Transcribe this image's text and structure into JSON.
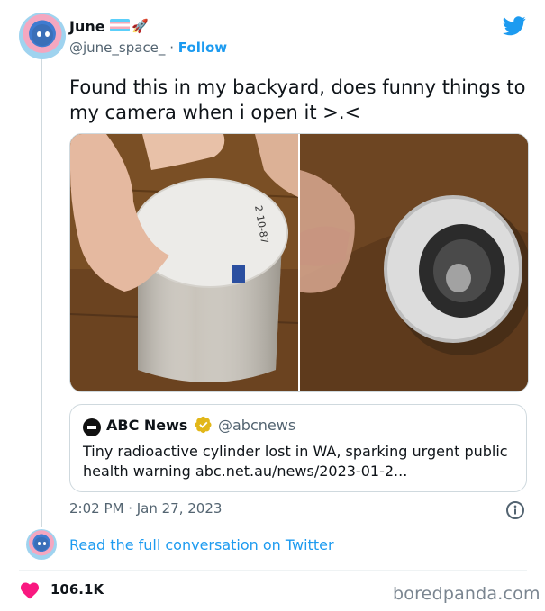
{
  "author": {
    "name": "June",
    "handle": "@june_space_",
    "follow_label": "Follow",
    "separator": "·",
    "badges": [
      "transgender-flag-emoji",
      "rocket-emoji"
    ]
  },
  "tweet": {
    "text": "Found this in my backyard, does funny things to my camera when i open it >.<",
    "timestamp": "2:02 PM · Jan 27, 2023",
    "likes": "106.1K"
  },
  "media": {
    "photos": [
      "hand-holding-white-cylinder-photo",
      "glowing-cylinder-opening-photo"
    ],
    "label_on_cylinder": "2-10-87"
  },
  "quoted_tweet": {
    "name": "ABC News",
    "handle": "@abcnews",
    "text": "Tiny radioactive cylinder lost in WA, sparking urgent public health warning abc.net.au/news/2023-01-2..."
  },
  "footer": {
    "read_more": "Read the full conversation on Twitter",
    "brand": "boredpanda.com"
  },
  "colors": {
    "link": "#1d9bf0",
    "heart": "#f91880",
    "verified": "#e2b719",
    "secondary_text": "#536471"
  }
}
